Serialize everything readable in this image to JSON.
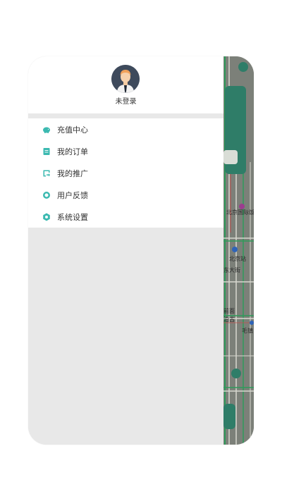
{
  "profile": {
    "login_label": "未登录"
  },
  "menu": {
    "items": [
      {
        "label": "充值中心",
        "icon": "piggy-bank-icon"
      },
      {
        "label": "我的订单",
        "icon": "order-icon"
      },
      {
        "label": "我的推广",
        "icon": "share-icon"
      },
      {
        "label": "用户反馈",
        "icon": "feedback-icon"
      },
      {
        "label": "系统设置",
        "icon": "gear-icon"
      }
    ]
  },
  "map": {
    "labels": [
      "北京国际饭",
      "北京站",
      "东大街",
      "前面",
      "泊古",
      "毛镇"
    ]
  },
  "colors": {
    "accent": "#3bb9b0",
    "map_panel": "#2f7d68"
  }
}
